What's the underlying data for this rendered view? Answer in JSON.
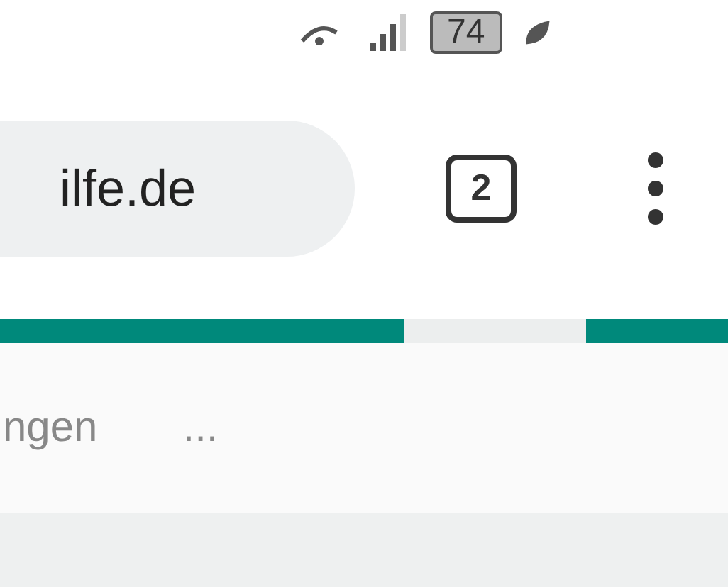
{
  "status_bar": {
    "battery": "74"
  },
  "toolbar": {
    "url": "ilfe.de",
    "tab_count": "2"
  },
  "menu_row": {
    "items": [
      "ngen",
      "..."
    ]
  }
}
